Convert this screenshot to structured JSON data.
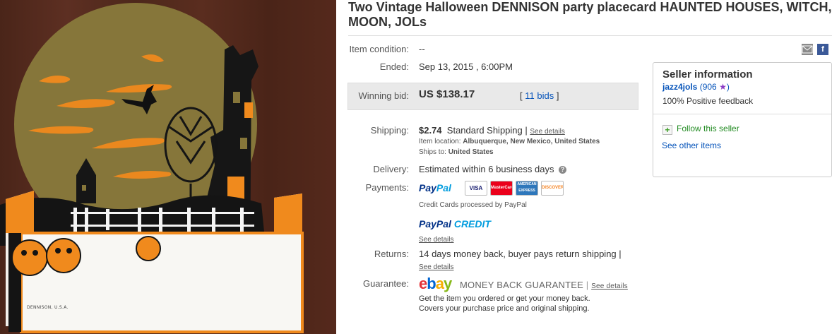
{
  "listing": {
    "title": "Two Vintage Halloween DENNISON party placecard HAUNTED HOUSES, WITCH, MOON, JOLs"
  },
  "image": {
    "maker_mark": "DENNISON, U.S.A."
  },
  "details": {
    "condition_label": "Item condition:",
    "condition_value": "--",
    "ended_label": "Ended:",
    "ended_value": "Sep 13, 2015 , 6:00PM",
    "winning_bid_label": "Winning bid:",
    "winning_bid_value": "US $138.17",
    "bids_link": "11 bids",
    "shipping_label": "Shipping:",
    "shipping_price": "$2.74",
    "shipping_method": "Standard Shipping",
    "shipping_see_details": "See details",
    "item_location_label": "Item location:",
    "item_location_value": "Albuquerque, New Mexico, United States",
    "ships_to_label": "Ships to:",
    "ships_to_value": "United States",
    "delivery_label": "Delivery:",
    "delivery_value": "Estimated within 6 business days",
    "payments_label": "Payments:",
    "paypal_logo_1": "Pay",
    "paypal_logo_2": "Pal",
    "cards": [
      "VISA",
      "MasterCard",
      "AMERICAN EXPRESS",
      "DISCOVER"
    ],
    "credit_cards_text": "Credit Cards processed by PayPal",
    "paypal_credit_logo_1": "PayPal",
    "paypal_credit_logo_2": "CREDIT",
    "paypal_credit_see_details": "See details",
    "returns_label": "Returns:",
    "returns_value": "14 days money back, buyer pays return shipping |",
    "returns_see_details": "See details",
    "guarantee_label": "Guarantee:",
    "guarantee_logo_letters": [
      "e",
      "b",
      "a",
      "y"
    ],
    "guarantee_title": "MONEY BACK GUARANTEE",
    "guarantee_see_details": "See details",
    "guarantee_line1": "Get the item you ordered or get your money back.",
    "guarantee_line2": "Covers your purchase price and original shipping."
  },
  "seller": {
    "heading": "Seller information",
    "username": "jazz4jols",
    "feedback_score": "(906",
    "feedback_close": ")",
    "positive_feedback": "100% Positive feedback",
    "follow": "Follow this seller",
    "see_other_items": "See other items"
  },
  "share": {
    "email_icon": "envelope-icon",
    "facebook_icon": "facebook-icon",
    "facebook_letter": "f"
  },
  "colors": {
    "link": "#0654ba",
    "bid_box": "#e9e9e9",
    "star": "#8c3ec6",
    "moon": "#86763a",
    "orange": "#f08a1d"
  }
}
